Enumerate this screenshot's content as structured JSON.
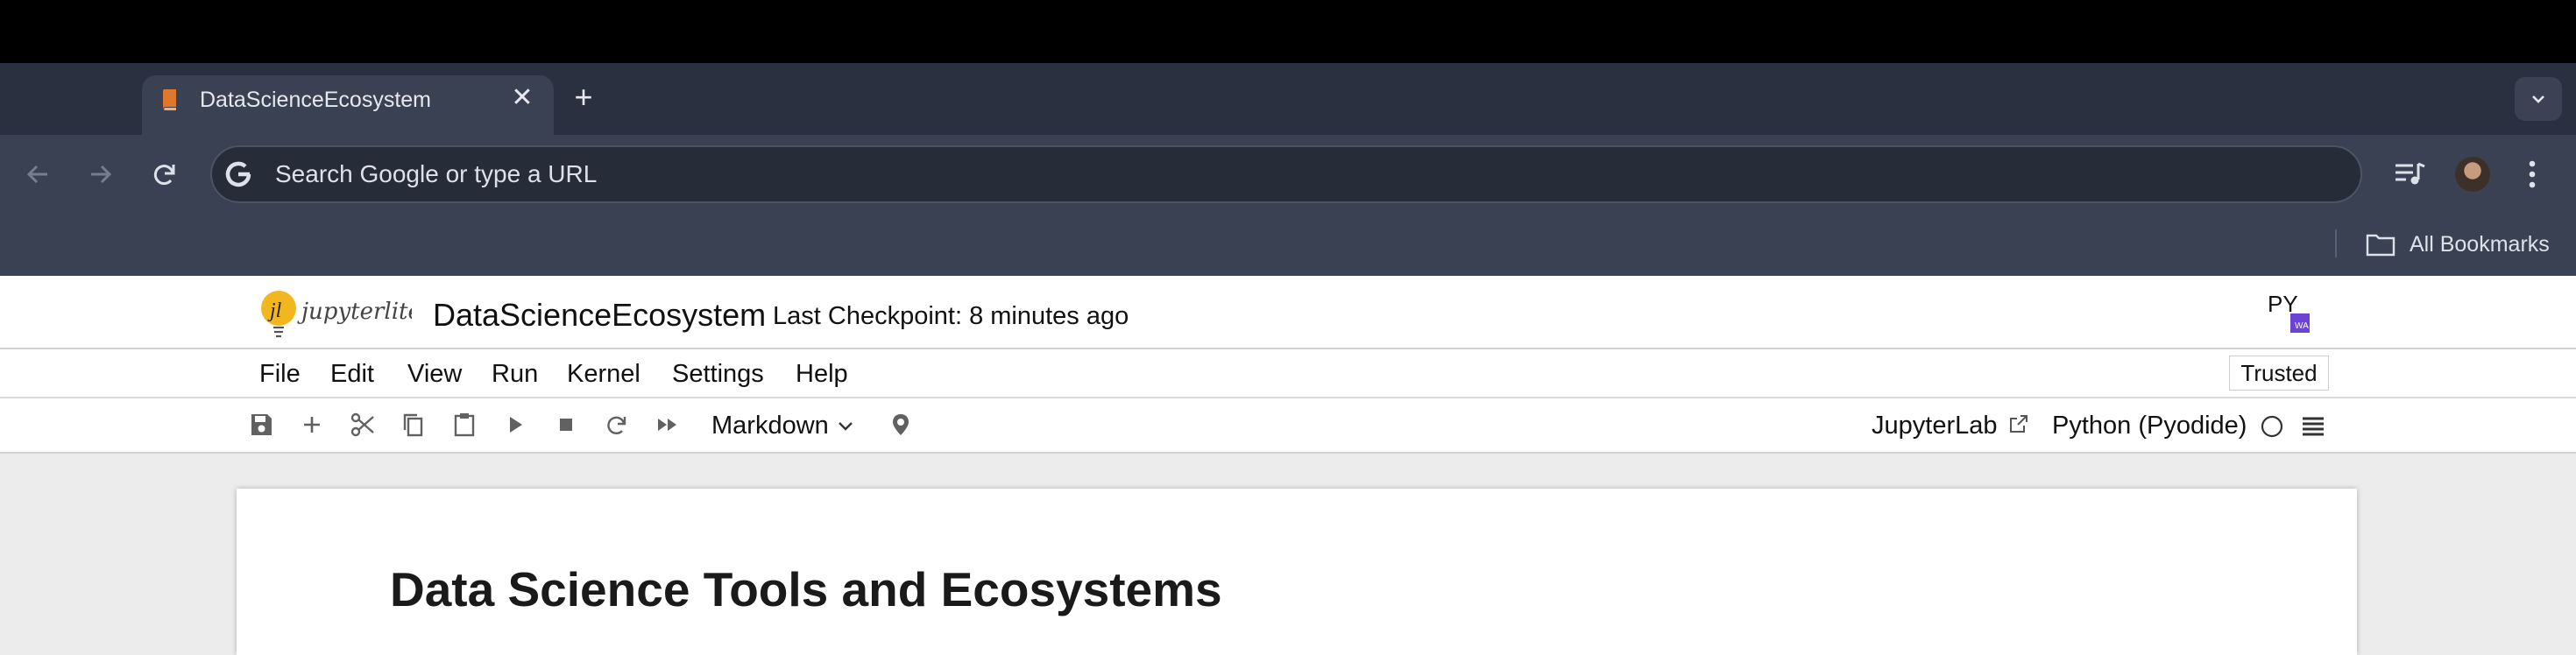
{
  "browser": {
    "tab": {
      "title": "DataScienceEcosystem",
      "favicon": "book-icon",
      "close_glyph": "✕"
    },
    "new_tab_glyph": "+",
    "omnibox": {
      "placeholder": "Search Google or type a URL"
    },
    "bookmarks": {
      "all_label": "All Bookmarks"
    },
    "colors": {
      "frame": "#2b3040",
      "toolbar": "#3a4152",
      "omnibox": "#272c39"
    }
  },
  "jupyter": {
    "brand": "jupyterlite",
    "notebook_title": "DataScienceEcosystem",
    "checkpoint": "Last Checkpoint: 8 minutes ago",
    "menu": [
      "File",
      "Edit",
      "View",
      "Run",
      "Kernel",
      "Settings",
      "Help"
    ],
    "trusted_label": "Trusted",
    "toolbar": {
      "icons": [
        "save-icon",
        "add-cell-icon",
        "cut-icon",
        "copy-icon",
        "paste-icon",
        "run-icon",
        "stop-icon",
        "restart-icon",
        "run-all-icon"
      ],
      "cell_type": "Markdown",
      "open_in": "JupyterLab",
      "kernel": "Python (Pyodide)"
    },
    "colors": {
      "logo_accent": "#f2b61e",
      "py_logo_accent": "#6b43d6"
    }
  },
  "notebook": {
    "heading": "Data Science Tools and Ecosystems"
  }
}
